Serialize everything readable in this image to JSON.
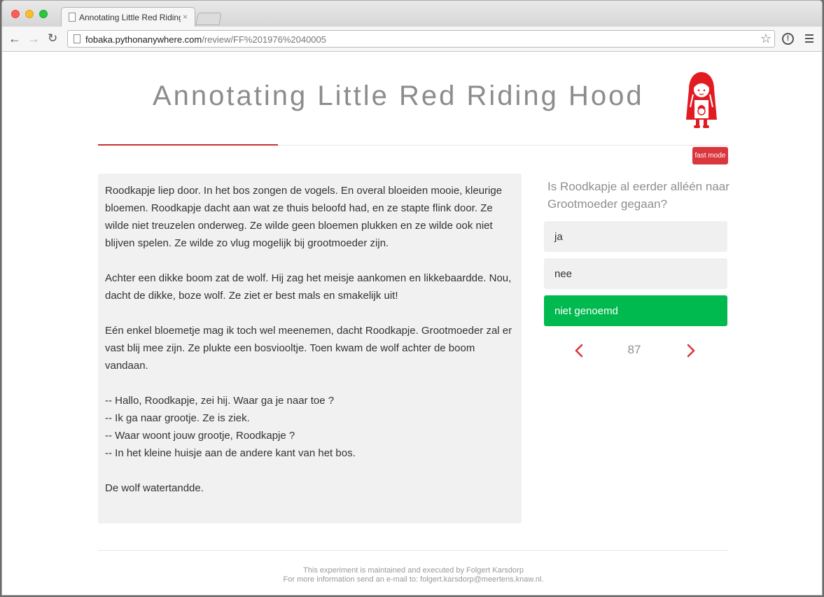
{
  "browser": {
    "tab_title": "Annotating Little Red Riding",
    "tab_close": "×",
    "url_host": "fobaka.pythonanywhere.com",
    "url_path": "/review/FF%201976%2040005",
    "icons": {
      "back": "back-arrow-icon",
      "forward": "forward-arrow-icon",
      "reload": "reload-icon",
      "bookmark": "star-icon",
      "info": "info-icon",
      "menu": "menu-icon"
    }
  },
  "header": {
    "title": "Annotating Little Red Riding Hood",
    "logo": "red-riding-hood-icon",
    "fast_mode_label": "fast mode"
  },
  "story": {
    "paragraphs": [
      "Roodkapje liep door. In het bos zongen de vogels. En overal bloeiden mooie, kleurige bloemen. Roodkapje dacht aan wat ze thuis beloofd had, en ze stapte flink door. Ze wilde niet treuzelen onderweg. Ze wilde geen bloemen plukken en ze wilde ook niet blijven spelen. Ze wilde zo vlug mogelijk bij grootmoeder zijn.",
      "Achter een dikke boom zat de wolf. Hij zag het meisje aankomen en likkebaardde. Nou, dacht de dikke, boze wolf. Ze ziet er best mals en smakelijk uit!",
      "Eén enkel bloemetje mag ik toch wel meenemen, dacht Roodkapje. Grootmoeder zal er vast blij mee zijn. Ze plukte een bosviooltje. Toen kwam de wolf achter de boom vandaan.",
      "-- Hallo, Roodkapje, zei hij. Waar ga je naar toe ?",
      "-- Ik ga naar grootje. Ze is ziek.",
      "-- Waar woont jouw grootje, Roodkapje ?",
      "-- In het kleine huisje aan de andere kant van het bos.",
      "De wolf watertandde."
    ]
  },
  "question": {
    "text": "Is Roodkapje al eerder alléén naar Grootmoeder gegaan?",
    "answers": [
      "ja",
      "nee",
      "niet genoemd"
    ],
    "selected": "niet genoemd",
    "selected_color": "#00b94f"
  },
  "pager": {
    "number": "87",
    "prev_icon": "chevron-left-icon",
    "next_icon": "chevron-right-icon"
  },
  "footer": {
    "line1": "This experiment is maintained and executed by Folgert Karsdorp",
    "line2": "For more information send an e-mail to: folgert.karsdorp@meertens.knaw.nl."
  },
  "colors": {
    "accent": "#d9363e",
    "selected": "#00b94f",
    "panel": "#f1f1f1"
  }
}
